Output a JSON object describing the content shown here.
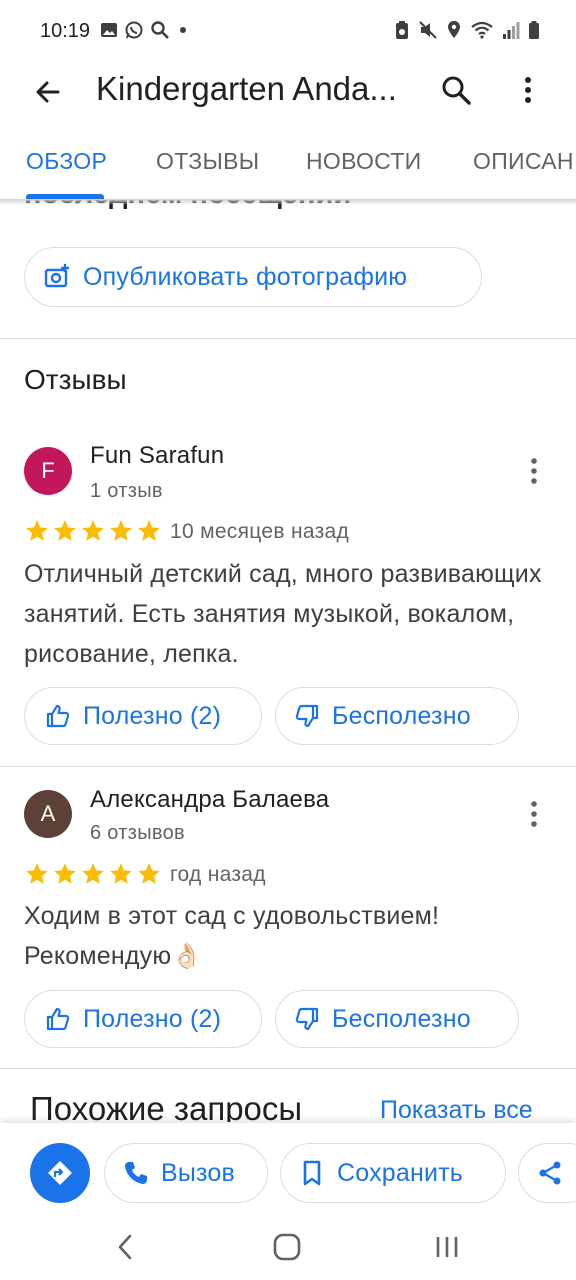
{
  "status_bar": {
    "time": "10:19"
  },
  "app_bar": {
    "title": "Kindergarten Anda..."
  },
  "tabs": [
    {
      "label": "ОБЗОР",
      "active": true
    },
    {
      "label": "ОТЗЫВЫ",
      "active": false
    },
    {
      "label": "НОВОСТИ",
      "active": false
    },
    {
      "label": "ОПИСАН",
      "active": false
    }
  ],
  "cut_off_text": "последнем посещении",
  "publish_photo": {
    "label": "Опубликовать фотографию"
  },
  "reviews_section": {
    "title": "Отзывы",
    "reviews": [
      {
        "avatar_letter": "F",
        "avatar_color": "#c2185b",
        "name": "Fun Sarafun",
        "count": "1 отзыв",
        "rating": 5,
        "date": "10 месяцев назад",
        "text": "Отличный детский сад, много развивающих занятий. Есть занятия музыкой, вокалом, рисование, лепка.",
        "helpful": "Полезно (2)",
        "not_helpful": "Бесполезно"
      },
      {
        "avatar_letter": "А",
        "avatar_color": "#5d4037",
        "name": "Александра Балаева",
        "count": "6 отзывов",
        "rating": 5,
        "date": "год назад",
        "text": "Ходим в этот сад с удовольствием! Рекомендую👌🏻",
        "helpful": "Полезно (2)",
        "not_helpful": "Бесполезно"
      }
    ]
  },
  "similar": {
    "title": "Похожие запросы",
    "show_all": "Показать все"
  },
  "action_bar": {
    "call": "Вызов",
    "save": "Сохранить"
  },
  "colors": {
    "accent": "#1a73e8",
    "star": "#fbbc04",
    "text": "#202124",
    "secondary": "#5f6368",
    "divider": "#dadce0"
  }
}
